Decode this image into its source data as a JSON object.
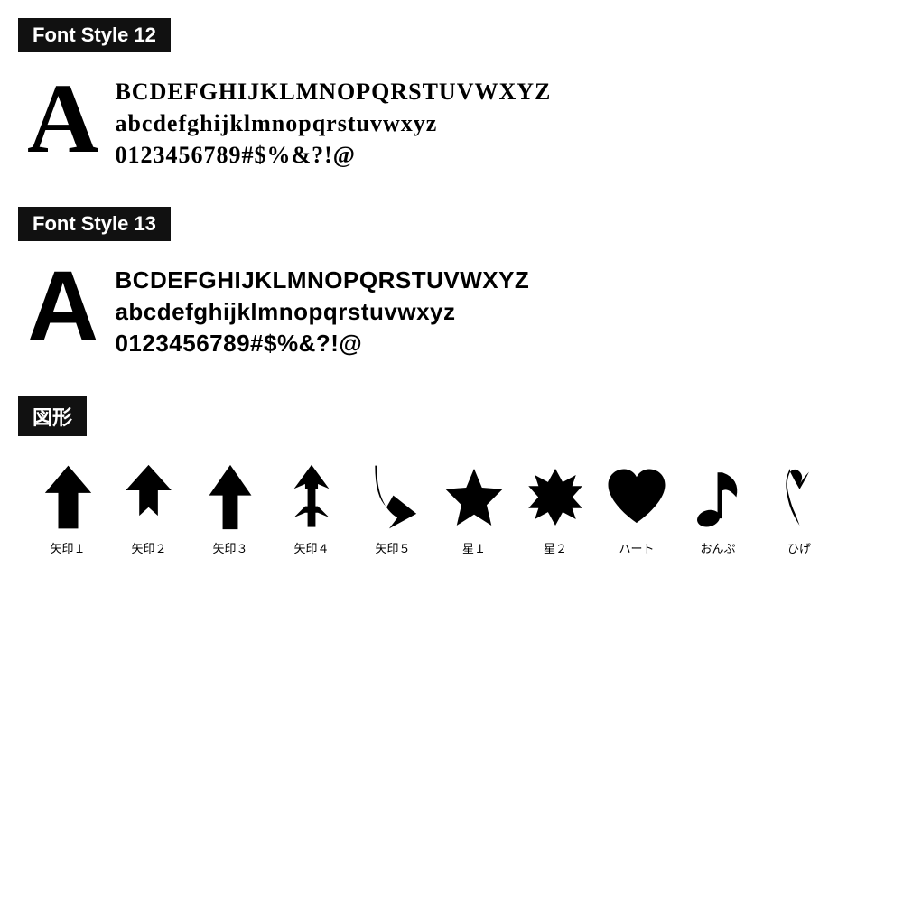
{
  "font_style_12": {
    "badge": "Font Style 12",
    "big_letter": "A",
    "line1": "BCDEFGHIJKLMNOPQRSTUVWXYZ",
    "line2": "abcdefghijklmnopqrstuvwxyz",
    "line3": "0123456789#$%&?!@"
  },
  "font_style_13": {
    "badge": "Font Style 13",
    "big_letter": "A",
    "line1": "BCDEFGHIJKLMNOPQRSTUVWXYZ",
    "line2": "abcdefghijklmnopqrstuvwxyz",
    "line3": "0123456789#$%&?!@"
  },
  "shapes": {
    "badge": "図形",
    "items": [
      {
        "label": "矢印１"
      },
      {
        "label": "矢印２"
      },
      {
        "label": "矢印３"
      },
      {
        "label": "矢印４"
      },
      {
        "label": "矢印５"
      },
      {
        "label": "星１"
      },
      {
        "label": "星２"
      },
      {
        "label": "ハート"
      },
      {
        "label": "おんぷ"
      },
      {
        "label": "ひげ"
      }
    ]
  }
}
